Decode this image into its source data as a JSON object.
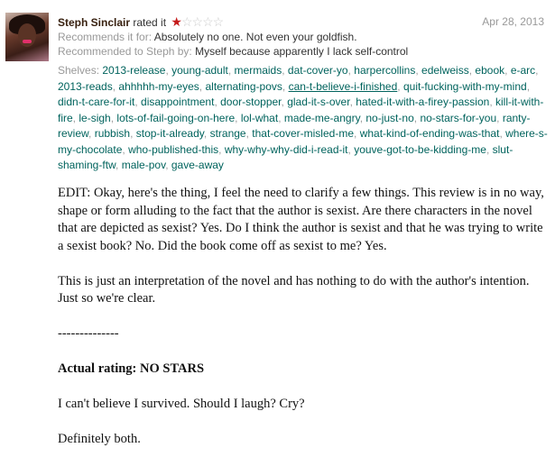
{
  "review": {
    "reviewer_name": "Steph Sinclair",
    "rated_text": "rated it",
    "rating": {
      "value": 1,
      "max": 5,
      "filled_glyph": "★",
      "empty_glyph": "☆"
    },
    "date": "Apr 28, 2013",
    "recommends_label": "Recommends it for:",
    "recommends_value": "Absolutely no one. Not even your goldfish.",
    "recommended_label": "Recommended to Steph by:",
    "recommended_value": "Myself because apparently I lack self-control",
    "shelves_label": "Shelves:",
    "shelves": [
      "2013-release",
      "young-adult",
      "mermaids",
      "dat-cover-yo",
      "harpercollins",
      "edelweiss",
      "ebook",
      "e-arc",
      "2013-reads",
      "ahhhhh-my-eyes",
      "alternating-povs",
      "can-t-believe-i-finished",
      "quit-fucking-with-my-mind",
      "didn-t-care-for-it",
      "disappointment",
      "door-stopper",
      "glad-it-s-over",
      "hated-it-with-a-firey-passion",
      "kill-it-with-fire",
      "le-sigh",
      "lots-of-fail-going-on-here",
      "lol-what",
      "made-me-angry",
      "no-just-no",
      "no-stars-for-you",
      "ranty-review",
      "rubbish",
      "stop-it-already",
      "strange",
      "that-cover-misled-me",
      "what-kind-of-ending-was-that",
      "where-s-my-chocolate",
      "who-published-this",
      "why-why-why-did-i-read-it",
      "youve-got-to-be-kidding-me",
      "slut-shaming-ftw",
      "male-pov",
      "gave-away"
    ],
    "underlined_shelf": "can-t-believe-i-finished",
    "body": {
      "p1": "EDIT: Okay, here's the thing, I feel the need to clarify a few things. This review is in no way, shape or form alluding to the fact that the author is sexist. Are there characters in the novel that are depicted as sexist? Yes. Do I think the author is sexist and that he was trying to write a sexist book? No. Did the book come off as sexist to me? Yes.",
      "p2": "This is just an interpretation of the novel and has nothing to do with the author's intention. Just so we're clear.",
      "divider": "--------------",
      "rating_line": "Actual rating: NO STARS",
      "p3": "I can't believe I survived. Should I laugh? Cry?",
      "p4": "Definitely both."
    }
  },
  "colors": {
    "reviewer": "#382110",
    "star_filled": "#c41a1a",
    "star_empty": "#cccccc",
    "shelf_link": "#00635d",
    "label_gray": "#999999"
  }
}
